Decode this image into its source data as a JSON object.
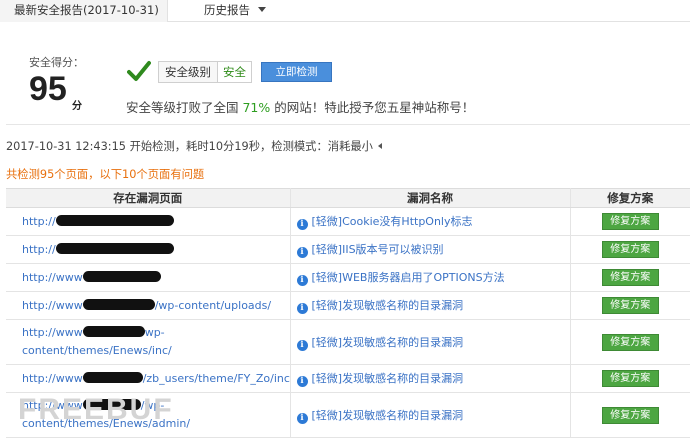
{
  "tabs": {
    "active_label": "最新安全报告(2017-10-31)",
    "history_label": "历史报告"
  },
  "score": {
    "label": "安全得分：",
    "value": "95",
    "unit": "分"
  },
  "level": {
    "label": "安全级别",
    "value": "安全"
  },
  "scan_button_label": "立即检测",
  "summary": {
    "prefix": "安全等级打败了全国 ",
    "percent": "71%",
    "suffix": " 的网站！特此授予您五星神站称号！"
  },
  "meta_line": "2017-10-31 12:43:15 开始检测，耗时10分19秒，检测模式：消耗最小",
  "issue_count_text": "共检测95个页面，以下10个页面有问题",
  "table": {
    "headers": [
      "存在漏洞页面",
      "漏洞名称",
      "修复方案"
    ],
    "rows": [
      {
        "url_parts": [
          "http://",
          "",
          ""
        ],
        "vuln": "[轻微]Cookie没有HttpOnly标志",
        "fix": "修复方案"
      },
      {
        "url_parts": [
          "http://",
          "",
          ""
        ],
        "vuln": "[轻微]IIS版本号可以被识别",
        "fix": "修复方案"
      },
      {
        "url_parts": [
          "http://www",
          "",
          ""
        ],
        "vuln": "[轻微]WEB服务器启用了OPTIONS方法",
        "fix": "修复方案"
      },
      {
        "url_parts": [
          "http://www",
          "",
          "/wp-content/uploads/"
        ],
        "vuln": "[轻微]发现敏感名称的目录漏洞",
        "fix": "修复方案"
      },
      {
        "url_parts": [
          "http://www",
          "",
          "wp-content/themes/Enews/inc/"
        ],
        "vuln": "[轻微]发现敏感名称的目录漏洞",
        "fix": "修复方案"
      },
      {
        "url_parts": [
          "http://www",
          "",
          "/zb_users/theme/FY_Zo/incluc"
        ],
        "vuln": "[轻微]发现敏感名称的目录漏洞",
        "fix": "修复方案"
      },
      {
        "url_parts": [
          "http://www",
          "",
          "/wp-content/themes/Enews/admin/"
        ],
        "vuln": "[轻微]发现敏感名称的目录漏洞",
        "fix": "修复方案"
      }
    ]
  },
  "watermark": "FREEBUF",
  "icons": {
    "check": "check-icon",
    "info": "info-icon",
    "caret": "chevron-down-icon"
  },
  "colors": {
    "accent_blue": "#4a8fdc",
    "fix_green": "#4da642",
    "safe_green": "#2e8b18",
    "warning_orange": "#e8700e",
    "link_blue": "#3a72c5"
  }
}
